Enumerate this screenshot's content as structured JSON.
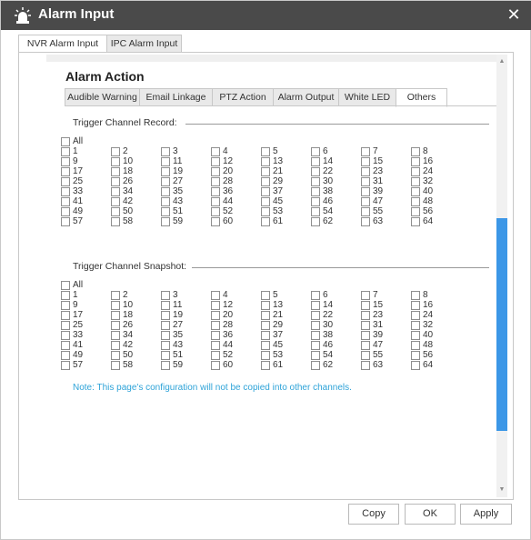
{
  "dialog": {
    "title": "Alarm Input",
    "close_symbol": "✕"
  },
  "outer_tabs": [
    {
      "label": "NVR Alarm Input",
      "active": true
    },
    {
      "label": "IPC Alarm Input",
      "active": false
    }
  ],
  "section_title": "Alarm Action",
  "inner_tabs": [
    {
      "label": "Audible Warning",
      "active": false
    },
    {
      "label": "Email Linkage",
      "active": false
    },
    {
      "label": "PTZ Action",
      "active": false
    },
    {
      "label": "Alarm Output",
      "active": false
    },
    {
      "label": "White LED",
      "active": false
    },
    {
      "label": "Others",
      "active": true
    }
  ],
  "groups": [
    {
      "title": "Trigger Channel Record:",
      "all_label": "All",
      "channels": [
        "1",
        "2",
        "3",
        "4",
        "5",
        "6",
        "7",
        "8",
        "9",
        "10",
        "11",
        "12",
        "13",
        "14",
        "15",
        "16",
        "17",
        "18",
        "19",
        "20",
        "21",
        "22",
        "23",
        "24",
        "25",
        "26",
        "27",
        "28",
        "29",
        "30",
        "31",
        "32",
        "33",
        "34",
        "35",
        "36",
        "37",
        "38",
        "39",
        "40",
        "41",
        "42",
        "43",
        "44",
        "45",
        "46",
        "47",
        "48",
        "49",
        "50",
        "51",
        "52",
        "53",
        "54",
        "55",
        "56",
        "57",
        "58",
        "59",
        "60",
        "61",
        "62",
        "63",
        "64"
      ]
    },
    {
      "title": "Trigger Channel Snapshot:",
      "all_label": "All",
      "channels": [
        "1",
        "2",
        "3",
        "4",
        "5",
        "6",
        "7",
        "8",
        "9",
        "10",
        "11",
        "12",
        "13",
        "14",
        "15",
        "16",
        "17",
        "18",
        "19",
        "20",
        "21",
        "22",
        "23",
        "24",
        "25",
        "26",
        "27",
        "28",
        "29",
        "30",
        "31",
        "32",
        "33",
        "34",
        "35",
        "36",
        "37",
        "38",
        "39",
        "40",
        "41",
        "42",
        "43",
        "44",
        "45",
        "46",
        "47",
        "48",
        "49",
        "50",
        "51",
        "52",
        "53",
        "54",
        "55",
        "56",
        "57",
        "58",
        "59",
        "60",
        "61",
        "62",
        "63",
        "64"
      ]
    }
  ],
  "note": "Note: This page's configuration will not be copied into other channels.",
  "buttons": {
    "copy": "Copy",
    "ok": "OK",
    "apply": "Apply"
  },
  "scroll": {
    "up_symbol": "▲",
    "down_symbol": "▼",
    "accent_color": "#3c97e7"
  },
  "icons": {
    "title": "alarm-siren-icon",
    "close": "close-icon"
  },
  "colors": {
    "titlebar": "#4a4a4a",
    "note": "#2ea3d8",
    "scroll_thumb": "#3c97e7"
  }
}
